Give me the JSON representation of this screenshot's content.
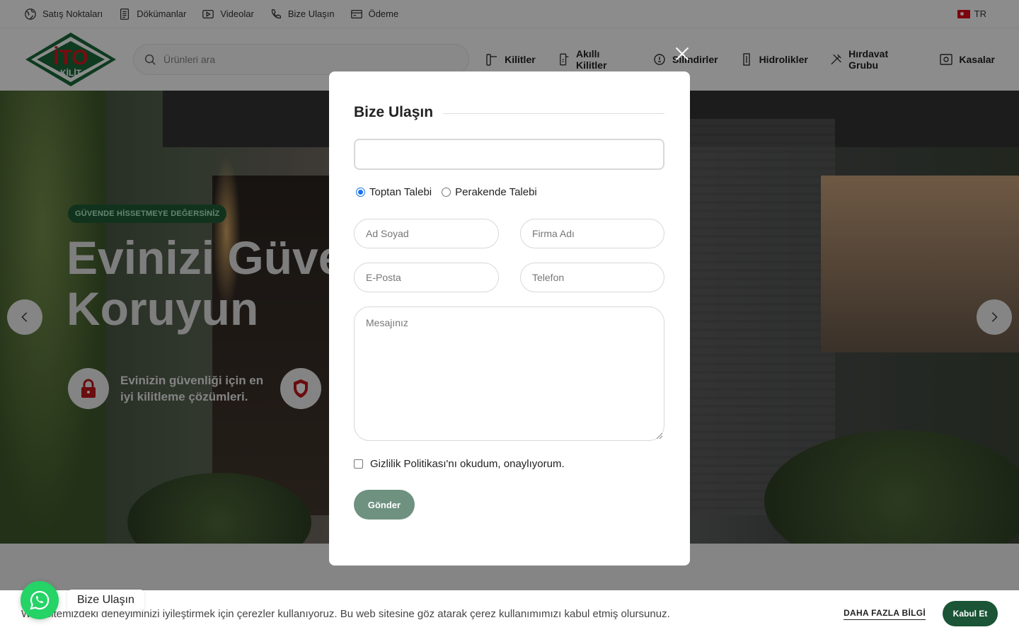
{
  "topbar": {
    "links": [
      {
        "label": "Satış Noktaları",
        "icon": "globe-icon"
      },
      {
        "label": "Dökümanlar",
        "icon": "document-icon"
      },
      {
        "label": "Videolar",
        "icon": "video-icon"
      },
      {
        "label": "Bize Ulaşın",
        "icon": "phone-icon"
      },
      {
        "label": "Ödeme",
        "icon": "card-icon"
      }
    ],
    "language": "TR"
  },
  "header": {
    "logo_text_top": "İTO",
    "logo_text_bottom": "KİLİT",
    "search_placeholder": "Ürünleri ara",
    "nav": [
      {
        "label": "Kilitler",
        "icon": "lock-handle-icon"
      },
      {
        "label": "Akıllı Kilitler",
        "icon": "smart-lock-icon"
      },
      {
        "label": "Silindirler",
        "icon": "cylinder-icon"
      },
      {
        "label": "Hidrolikler",
        "icon": "hydraulic-icon"
      },
      {
        "label": "Hırdavat Grubu",
        "icon": "tools-icon"
      },
      {
        "label": "Kasalar",
        "icon": "safe-icon"
      }
    ]
  },
  "hero": {
    "badge": "GÜVENDE HİSSETMEYE DEĞERSİNİZ",
    "title_line1": "Evinizi Güve",
    "title_line2": "Koruyun",
    "feature1": "Evinizin güvenliği için en iyi kilitleme çözümleri."
  },
  "modal": {
    "title": "Bize Ulaşın",
    "radio_options": [
      "Toptan Talebi",
      "Perakende Talebi"
    ],
    "selected_radio": "Toptan Talebi",
    "fields": {
      "name": "Ad Soyad",
      "company": "Firma Adı",
      "email": "E-Posta",
      "phone": "Telefon",
      "message": "Mesajınız"
    },
    "consent": "Gizlilik Politikası'nı okudum, onaylıyorum.",
    "submit": "Gönder"
  },
  "cookie": {
    "text": "Web sitemizdeki deneyiminizi iyileştirmek için çerezler kullanıyoruz. Bu web sitesine göz atarak çerez kullanımımızı kabul etmiş olursunuz.",
    "more": "DAHA FAZLA BİLGİ",
    "accept": "Kabul Et"
  },
  "whatsapp": {
    "label": "Bize Ulaşın"
  },
  "colors": {
    "brand_green": "#1b5436",
    "submit": "#6e9180",
    "logo_red": "#d71920"
  }
}
